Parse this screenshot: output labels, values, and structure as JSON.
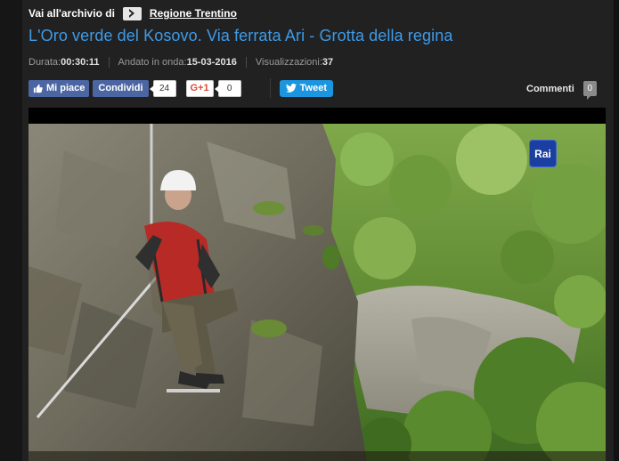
{
  "breadcrumb": {
    "label": "Vai all'archivio di",
    "link": "Regione Trentino"
  },
  "video": {
    "title": "L'Oro verde del Kosovo. Via ferrata Ari - Grotta della regina",
    "duration_label": "Durata:",
    "duration": "00:30:11",
    "aired_label": "Andato in onda:",
    "aired": "15-03-2016",
    "views_label": "Visualizzazioni:",
    "views": "37",
    "channel_logo": "Rai"
  },
  "social": {
    "like_label": "Mi piace",
    "share_label": "Condividi",
    "share_count": "24",
    "gplus_label": "G+1",
    "gplus_count": "0",
    "tweet_label": "Tweet"
  },
  "comments": {
    "label": "Commenti",
    "count": "0"
  },
  "colors": {
    "title": "#3d9be9",
    "facebook": "#4c66a4",
    "twitter": "#1b95e0",
    "gplus": "#dd4b39",
    "background": "#212121"
  },
  "icons": [
    "chevron-right-icon",
    "thumbs-up-icon",
    "twitter-bird-icon"
  ]
}
